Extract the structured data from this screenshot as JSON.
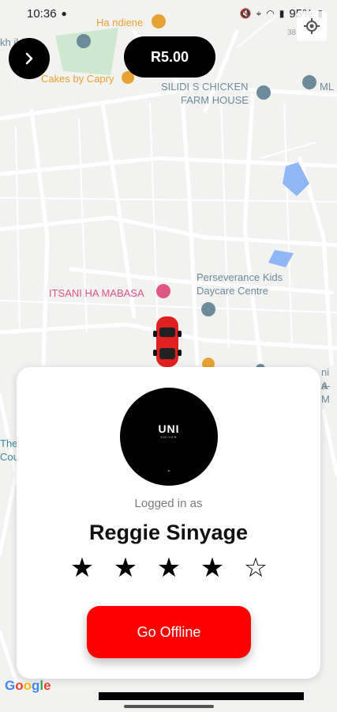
{
  "status_bar": {
    "time": "10:36",
    "battery": "95%"
  },
  "top_bar": {
    "fare": "R5.00",
    "menu_icon": "chevron-right-icon"
  },
  "map": {
    "labels": {
      "handiene": "Ha ndiene",
      "building": "kh    ilding",
      "cakes": "Cakes by Capry",
      "silidi_line1": "SILIDI S CHICKEN",
      "silidi_line2": "FARM HOUSE",
      "ml": "ML",
      "itsani": "ITSANI HA MABASA",
      "perseverance_line1": "Perseverance Kids",
      "perseverance_line2": "Daycare Centre",
      "the_line1": "The",
      "the_line2": "Cou",
      "ni_line1": "ni A",
      "ni_line2": "a-M",
      "corner": "38"
    },
    "colors": {
      "road": "#ffffff",
      "water": "#8fb7f5",
      "park": "#c8e6c9",
      "orange_poi": "#e8a133",
      "pink_poi": "#e05383",
      "blue_poi": "#6b8a9a"
    }
  },
  "profile": {
    "avatar_brand": "UNI",
    "avatar_sub": "DRIVER",
    "avatar_dot": "-",
    "logged_in_label": "Logged in as",
    "name": "Reggie Sinyage",
    "rating_filled": 4,
    "rating_max": 5,
    "stars": [
      "★",
      "★",
      "★",
      "★",
      "☆"
    ]
  },
  "actions": {
    "go_offline": "Go Offline"
  },
  "accent": "#ff0000",
  "footer": {
    "google_letters": [
      {
        "ch": "G",
        "color": "#4285f4"
      },
      {
        "ch": "o",
        "color": "#ea4335"
      },
      {
        "ch": "o",
        "color": "#fbbc05"
      },
      {
        "ch": "g",
        "color": "#4285f4"
      },
      {
        "ch": "l",
        "color": "#34a853"
      },
      {
        "ch": "e",
        "color": "#ea4335"
      }
    ]
  }
}
